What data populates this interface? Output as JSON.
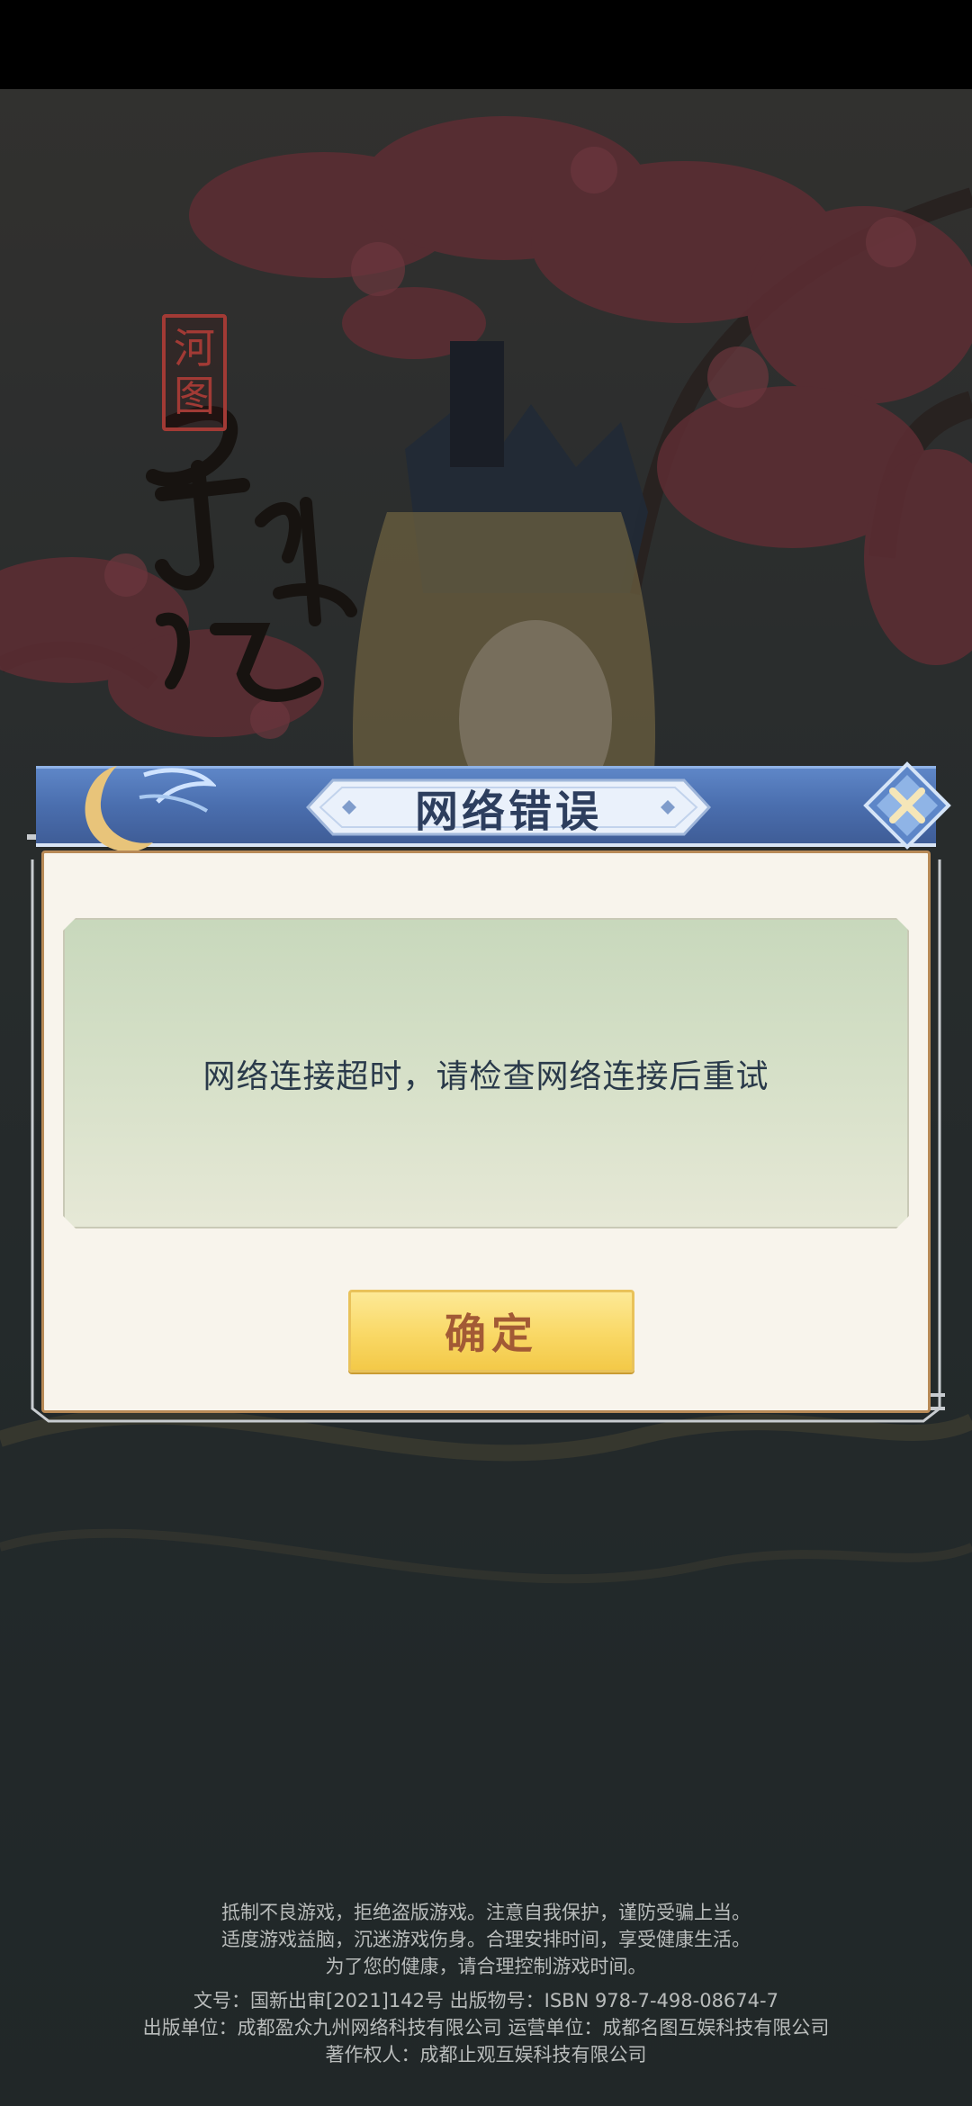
{
  "game": {
    "logo_text": "寻仙记",
    "logo_seal": "河图"
  },
  "dialog": {
    "title": "网络错误",
    "message": "网络连接超时，请检查网络连接后重试",
    "confirm_label": "确定",
    "close_icon": "close-x-icon"
  },
  "footer": {
    "health_notice": [
      "抵制不良游戏，拒绝盗版游戏。注意自我保护，谨防受骗上当。",
      "适度游戏益脑，沉迷游戏伤身。合理安排时间，享受健康生活。",
      "为了您的健康，请合理控制游戏时间。"
    ],
    "publication_info": [
      "文号：国新出审[2021]142号  出版物号：ISBN 978-7-498-08674-7",
      "出版单位：成都盈众九州网络科技有限公司  运营单位：成都名图互娱科技有限公司",
      "著作权人：成都止观互娱科技有限公司"
    ]
  },
  "colors": {
    "title_bar": "#4a6eae",
    "panel": "#f8f4ec",
    "confirm_button": "#f9d865",
    "seal_red": "#a23a35"
  }
}
